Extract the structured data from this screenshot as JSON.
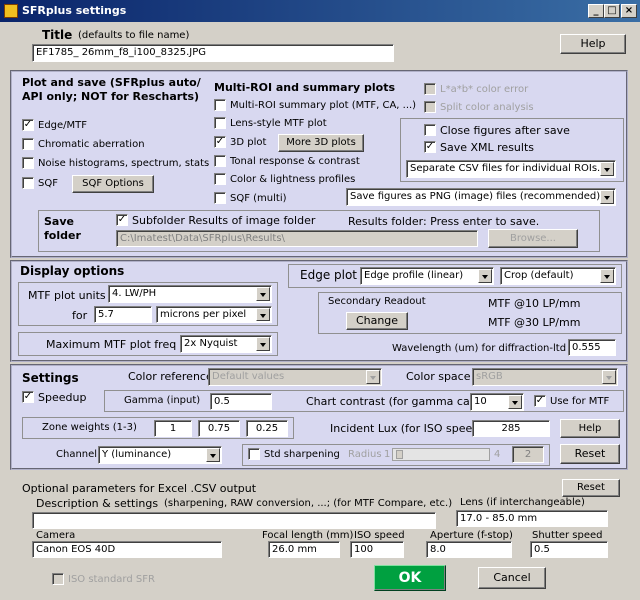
{
  "window": {
    "title": "SFRplus settings"
  },
  "title_section": {
    "label": "Title",
    "hint": "(defaults to file name)",
    "value": "EF1785_ 26mm_f8_i100_8325.JPG",
    "help_label": "Help"
  },
  "plot_save": {
    "heading": "Plot and save  (SFRplus auto/",
    "heading2": "API only;  NOT for Rescharts)",
    "edge_mtf": {
      "label": "Edge/MTF",
      "checked": true
    },
    "chromatic": {
      "label": "Chromatic aberration",
      "checked": false
    },
    "noise": {
      "label": "Noise histograms, spectrum, stats",
      "checked": false
    },
    "sqf": {
      "label": "SQF",
      "checked": false
    },
    "sqf_options": "SQF Options",
    "multi_heading": "Multi-ROI and summary plots",
    "multi_roi": {
      "label": "Multi-ROI summary plot (MTF, CA, ...)",
      "checked": false
    },
    "lens_style": {
      "label": "Lens-style MTF plot",
      "checked": false
    },
    "plot3d": {
      "label": "3D plot",
      "checked": true
    },
    "more3d": "More 3D plots",
    "tonal": {
      "label": "Tonal response & contrast",
      "checked": false
    },
    "color_light": {
      "label": "Color & lightness profiles",
      "checked": false
    },
    "sqf_multi": {
      "label": "SQF (multi)",
      "checked": false
    },
    "lab_error": {
      "label": "L*a*b* color error",
      "checked": false
    },
    "split_color": {
      "label": "Split color analysis",
      "checked": false
    },
    "close_figs": {
      "label": "Close figures after save",
      "checked": false
    },
    "save_xml": {
      "label": "Save XML results",
      "checked": true
    },
    "csv_select": "Separate CSV files for individual ROIs.",
    "png_select": "Save figures as PNG (image) files (recommended).",
    "save_folder_label": "Save",
    "save_folder_label2": "folder",
    "subfolder": {
      "label": "Subfolder Results of image folder",
      "checked": true
    },
    "results_folder_msg": "Results folder:  Press enter to save.",
    "folder_path": "C:\\Imatest\\Data\\SFRplus\\Results\\",
    "browse": "Browse..."
  },
  "display": {
    "heading": "Display options",
    "mtf_units_label": "MTF plot units",
    "mtf_units": "4. LW/PH",
    "for_label": "for",
    "for_value": "5.7",
    "microns_select": "microns per pixel",
    "max_freq_label": "Maximum MTF plot freq",
    "max_freq": "2x Nyquist",
    "edge_plot_label": "Edge plot",
    "edge_profile": "Edge profile (linear)",
    "crop": "Crop (default)",
    "secondary_label": "Secondary Readout",
    "change": "Change",
    "mtf10": "MTF @10 LP/mm",
    "mtf30": "MTF @30 LP/mm",
    "wavelength_label": "Wavelength (um) for diffraction-ltd MTF",
    "wavelength": "0.555"
  },
  "settings": {
    "heading": "Settings",
    "color_ref_label": "Color reference",
    "color_ref": "Default values",
    "color_space_label": "Color space",
    "color_space": "sRGB",
    "speedup": {
      "label": "Speedup",
      "checked": true
    },
    "gamma_label": "Gamma (input)",
    "gamma": "0.5",
    "chart_contrast_label": "Chart contrast (for gamma calc.)",
    "chart_contrast": "10",
    "use_mtf": {
      "label": "Use for MTF",
      "checked": true
    },
    "zone_label": "Zone weights (1-3)",
    "zone1": "1",
    "zone2": "0.75",
    "zone3": "0.25",
    "lux_label": "Incident Lux (for ISO speed)",
    "lux": "285",
    "help": "Help",
    "channel_label": "Channel",
    "channel": "Y (luminance)",
    "std_sharp": {
      "label": "Std sharpening",
      "checked": false
    },
    "radius_label": "Radius",
    "radius_min": "1",
    "radius_max": "4",
    "radius_value": "2",
    "reset": "Reset"
  },
  "optional": {
    "heading": "Optional parameters  for Excel .CSV output",
    "reset": "Reset",
    "desc_label": "Description & settings",
    "desc_hint": "(sharpening, RAW conversion, ...; (for MTF Compare, etc.)",
    "desc_value": "",
    "lens_label": "Lens (if interchangeable)",
    "lens_value": "17.0 - 85.0 mm",
    "camera_label": "Camera",
    "camera_value": "Canon EOS 40D",
    "focal_label": "Focal length (mm)",
    "focal_value": "26.0 mm",
    "iso_label": "ISO speed",
    "iso_value": "100",
    "aperture_label": "Aperture (f-stop)",
    "aperture_value": "8.0",
    "shutter_label": "Shutter speed",
    "shutter_value": "0.5"
  },
  "footer": {
    "iso_sfr": {
      "label": "ISO standard SFR",
      "checked": false
    },
    "ok": "OK",
    "cancel": "Cancel"
  },
  "colors": {
    "panel": "#d8d8f0",
    "ok_button": "#00a040",
    "titlebar": "#0a246a"
  }
}
